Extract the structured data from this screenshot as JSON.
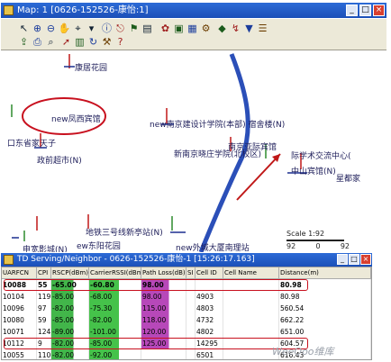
{
  "main_window": {
    "title": "Map: 1 [0626-152526-康怡:1]",
    "controls": [
      "_",
      "□",
      "×"
    ]
  },
  "toolbar": {
    "icons": [
      "pointer-icon",
      "zoom-in-icon",
      "zoom-out-icon",
      "grabber-icon",
      "selector-icon",
      "query-icon",
      "info-icon",
      "measure-icon",
      "label-icon",
      "ruler-icon",
      "cell-icon",
      "layer-icon",
      "drive-test-icon",
      "site-icon",
      "neighbor-icon",
      "route-icon",
      "filter-icon",
      "legend-icon",
      "export-icon",
      "print-icon",
      "find-icon",
      "arrow-icon",
      "grid-icon",
      "refresh-icon",
      "settings-icon",
      "help-icon"
    ]
  },
  "map": {
    "labels": {
      "l1": "康居花园",
      "l2": "new凤西宾馆",
      "l3": "口东省家天子",
      "l4": "政前超市(N)",
      "l5": "new南京建设计学院(本部) 宿舍楼(N)",
      "l6": "新南京晓庄学院(北校区)",
      "l7": "南京亚际宾馆",
      "l8": "际学术交流中心(",
      "l9": "中山宾馆(N)",
      "l10": "星都家",
      "l11": "地铁三号线新亭站(N)",
      "l12": "申宽影城(N)",
      "l13": "ew东阳花园",
      "l14": "new外城大厦南理站"
    },
    "scale": {
      "label": "Scale",
      "value": "1:92",
      "ticks": [
        "92",
        "0",
        "92"
      ]
    }
  },
  "serving_window": {
    "title": "TD Serving/Neighbor - 0626-152526-康怡-1 [15:26:17.163]",
    "controls": [
      "_",
      "□",
      "×"
    ],
    "columns": [
      "UARFCN",
      "CPI",
      "RSCP(dBm)",
      "CarrierRSSI(dBm)",
      "Path Loss(dB)",
      "SI",
      "Cell ID",
      "Cell Name",
      "Distance(m)"
    ],
    "rows": [
      [
        "10088",
        "55",
        "-65.00",
        "-60.80",
        "98.00",
        "",
        "",
        "",
        "80.98"
      ],
      [
        "10104",
        "119",
        "-85.00",
        "-68.00",
        "98.00",
        "",
        "4903",
        "",
        "80.98"
      ],
      [
        "10096",
        "97",
        "-82.00",
        "-75.30",
        "115.00",
        "",
        "4803",
        "",
        "560.54"
      ],
      [
        "10080",
        "59",
        "-85.00",
        "-82.00",
        "118.00",
        "",
        "4732",
        "",
        "662.22"
      ],
      [
        "10071",
        "124",
        "-89.00",
        "-101.00",
        "120.00",
        "",
        "4802",
        "",
        "651.00"
      ],
      [
        "10112",
        "9",
        "-82.00",
        "-85.00",
        "125.00",
        "",
        "14295",
        "",
        "604.57"
      ],
      [
        "10055",
        "110",
        "-82.00",
        "-92.00",
        "",
        "",
        "6501",
        "",
        "616.43"
      ]
    ]
  },
  "colors": {
    "title_bar": "#1b4fb8",
    "route": "#2b4fb8",
    "rscp_bar": "#42b64a",
    "rssi_bar": "#45c24a",
    "pathloss_bar": "#b748b9",
    "highlight_outline": "#c8101e"
  },
  "watermark": "WeeQoo维库"
}
